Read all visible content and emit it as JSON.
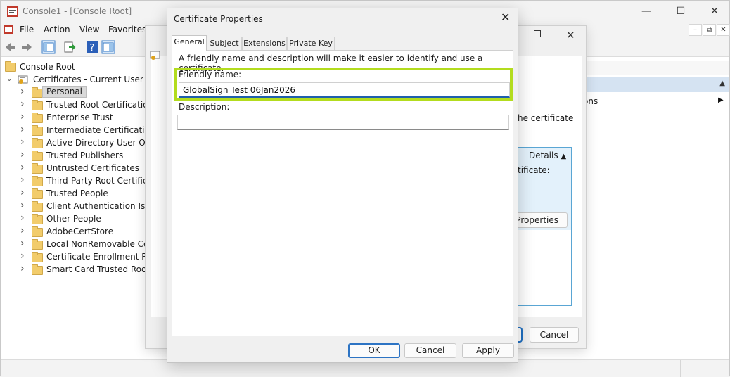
{
  "window": {
    "title": "Console1 - [Console Root]",
    "controls": [
      "—",
      "☐",
      "✕"
    ]
  },
  "menu": [
    "File",
    "Action",
    "View",
    "Favorites"
  ],
  "tree": {
    "root": "Console Root",
    "store": "Certificates - Current User",
    "items": [
      "Personal",
      "Trusted Root Certification A",
      "Enterprise Trust",
      "Intermediate Certification A",
      "Active Directory User Objec",
      "Trusted Publishers",
      "Untrusted Certificates",
      "Third-Party Root Certificatio",
      "Trusted People",
      "Client Authentication Issue",
      "Other People",
      "AdobeCertStore",
      "Local NonRemovable Certi",
      "Certificate Enrollment Requ",
      "Smart Card Trusted Roots"
    ],
    "selected_index": 0
  },
  "actions_panel": {
    "item": "ons"
  },
  "background_dialog": {
    "text": "he certificate",
    "details_label": "Details",
    "certificate_label": "tificate:",
    "properties_button": "Properties",
    "cancel_button": "Cancel"
  },
  "dialog": {
    "title": "Certificate Properties",
    "tabs": [
      "General",
      "Subject",
      "Extensions",
      "Private Key"
    ],
    "active_tab": "General",
    "intro": "A friendly name and description will make it easier to identify and use a certificate.",
    "friendly_name_label": "Friendly name:",
    "friendly_name_value": "GlobalSign Test 06Jan2026",
    "description_label": "Description:",
    "description_value": "",
    "buttons": {
      "ok": "OK",
      "cancel": "Cancel",
      "apply": "Apply"
    }
  },
  "colors": {
    "highlight": "#b3dc1e",
    "accent": "#1f5fad",
    "selection": "#d9d9d9"
  }
}
